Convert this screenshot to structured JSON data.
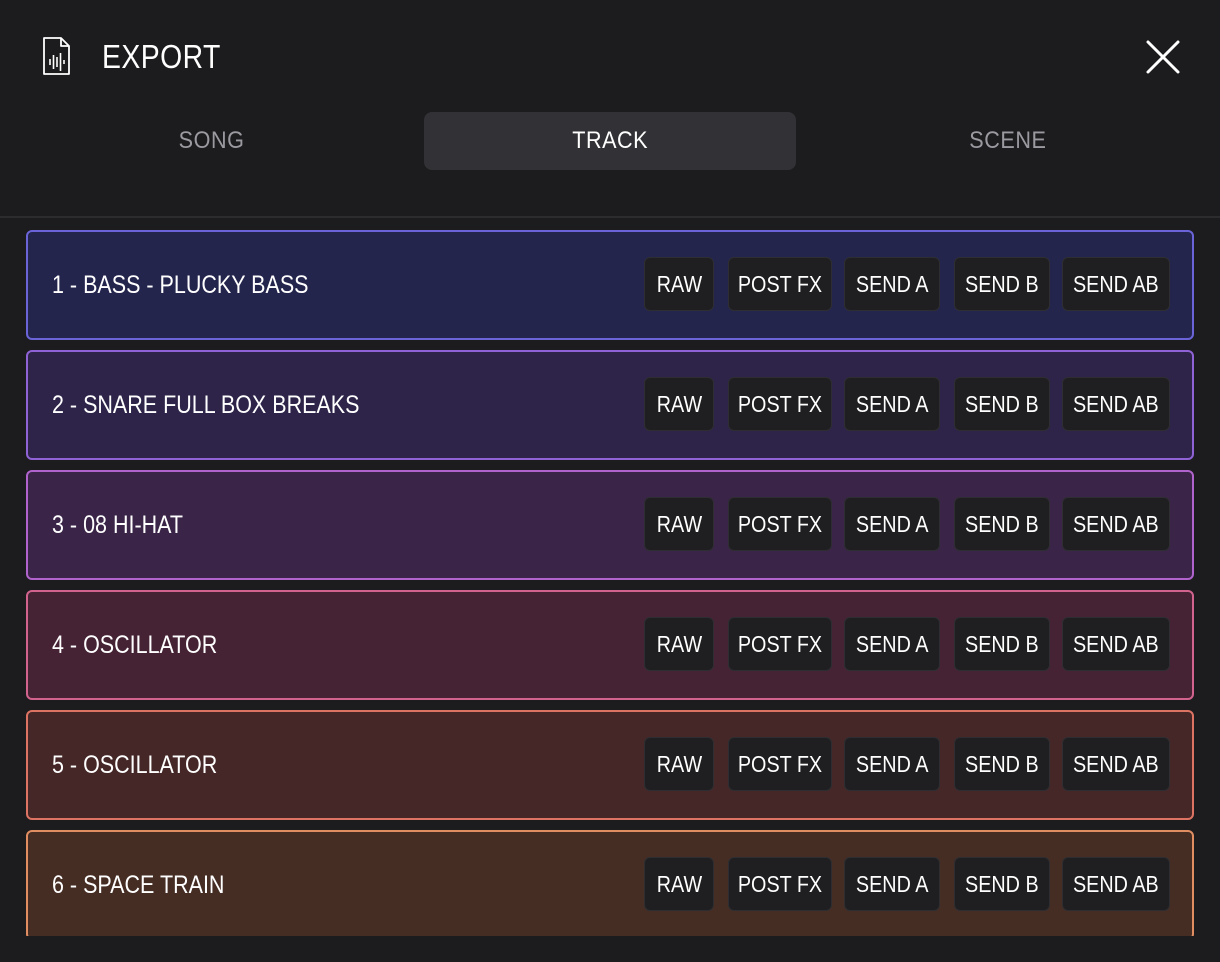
{
  "header": {
    "title": "EXPORT",
    "icon": "audio-file-icon",
    "close_icon": "close-icon"
  },
  "tabs": [
    {
      "label": "SONG",
      "active": false
    },
    {
      "label": "TRACK",
      "active": true
    },
    {
      "label": "SCENE",
      "active": false
    }
  ],
  "export_options": [
    "RAW",
    "POST FX",
    "SEND A",
    "SEND B",
    "SEND AB"
  ],
  "tracks": [
    {
      "name": "1 - BASS - PLUCKY BASS",
      "bg": "#23254d",
      "border": "#6a64d8"
    },
    {
      "name": "2 - SNARE FULL BOX BREAKS",
      "bg": "#2e2449",
      "border": "#8f62d6"
    },
    {
      "name": "3 - 08 HI-HAT",
      "bg": "#3a2447",
      "border": "#b063cc"
    },
    {
      "name": "4 - OSCILLATOR",
      "bg": "#452334",
      "border": "#d2638f"
    },
    {
      "name": "5 - OSCILLATOR",
      "bg": "#452727",
      "border": "#dd7363"
    },
    {
      "name": "6 - SPACE TRAIN",
      "bg": "#452d24",
      "border": "#e08d62"
    }
  ]
}
